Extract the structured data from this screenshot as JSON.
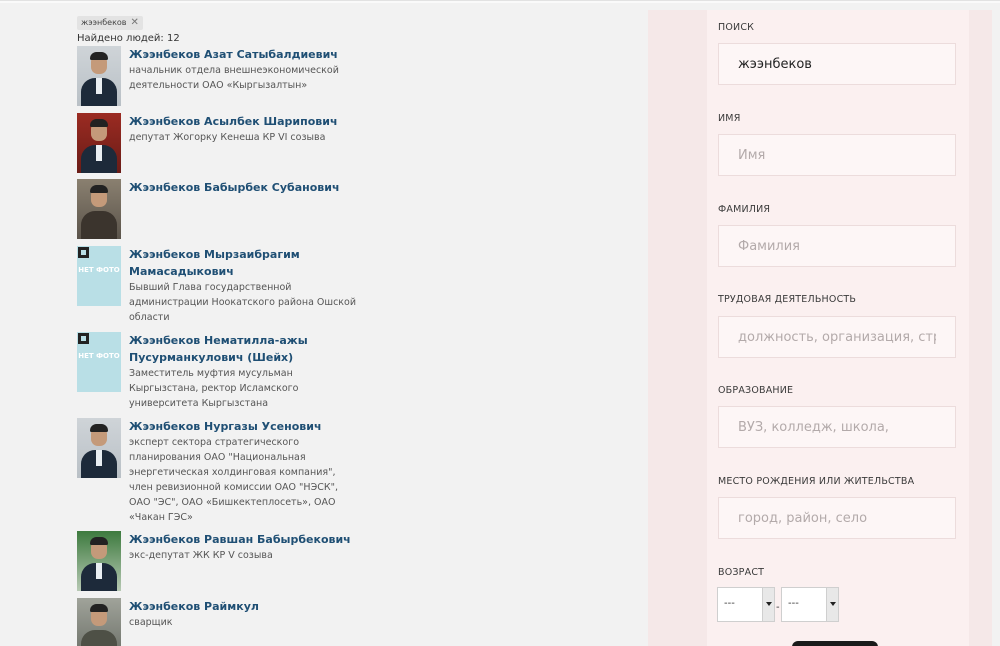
{
  "filter": {
    "tag_label": "жээнбеков",
    "tag_remove": "✕",
    "found_text": "Найдено людей: 12"
  },
  "people": [
    {
      "name": "Жээнбеков Азат Сатыбалдиевич",
      "desc": "начальник отдела внешнеэкономической деятельности ОАО «Кыргызалтын»"
    },
    {
      "name": "Жээнбеков Асылбек Шарипович",
      "desc": "депутат Жогорку Кенеша КР VI созыва"
    },
    {
      "name": "Жээнбеков Бабырбек Субанович",
      "desc": ""
    },
    {
      "name": "Жээнбеков Мырзаибрагим Мамасадыкович",
      "desc": "Бывший Глава государственной администрации Ноокатского района Ошской области"
    },
    {
      "name": "Жээнбеков Нематилла-ажы Пусурманкулович (Шейх)",
      "desc": "Заместитель муфтия мусульман Кыргызстана, ректор Исламского университета Кыргызстана"
    },
    {
      "name": "Жээнбеков Нургазы Усенович",
      "desc": "эксперт сектора стратегического планирования ОАО \"Национальная энергетическая холдинговая компания\", член ревизионной комиссии ОАО \"НЭСК\", ОАО \"ЭС\", ОАО «Бишкектеплосеть», ОАО «Чакан ГЭС»"
    },
    {
      "name": "Жээнбеков Равшан Бабырбекович",
      "desc": "экс-депутат ЖК КР V созыва"
    },
    {
      "name": "Жээнбеков Раймкул",
      "desc": "сварщик"
    }
  ],
  "no_photo_text": "НЕТ ФОТО",
  "search": {
    "search_label": "ПОИСК",
    "search_value": "жээнбеков",
    "first_name_label": "ИМЯ",
    "first_name_placeholder": "Имя",
    "last_name_label": "ФАМИЛИЯ",
    "last_name_placeholder": "Фамилия",
    "work_label": "ТРУДОВАЯ ДЕЯТЕЛЬНОСТЬ",
    "work_placeholder": "должность, организация, структура",
    "education_label": "ОБРАЗОВАНИЕ",
    "education_placeholder": "ВУЗ, колледж, школа,",
    "place_label": "МЕСТО РОЖДЕНИЯ ИЛИ ЖИТЕЛЬСТВА",
    "place_placeholder": "город, район, село",
    "age_label": "ВОЗРАСТ",
    "age_from": "---",
    "age_separator": "-",
    "age_to": "---"
  }
}
